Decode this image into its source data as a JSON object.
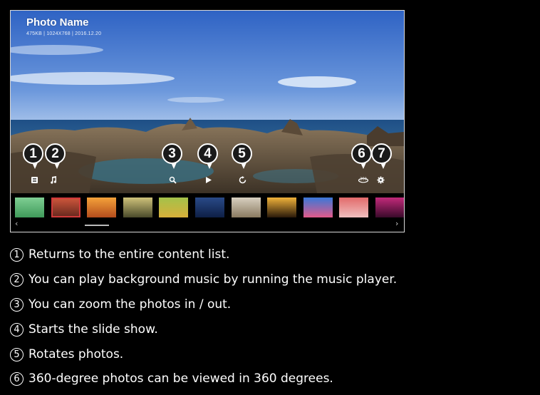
{
  "photo": {
    "title": "Photo Name",
    "meta": "475KB  |  1024X768  |  2016.12.20"
  },
  "controls": [
    {
      "icon": "content-list-icon"
    },
    {
      "icon": "music-note-icon"
    },
    {
      "icon": "zoom-icon"
    },
    {
      "icon": "play-icon"
    },
    {
      "icon": "rotate-icon"
    },
    {
      "icon": "360-view-icon"
    },
    {
      "icon": "settings-gear-icon"
    }
  ],
  "callouts": [
    "1",
    "2",
    "3",
    "4",
    "5",
    "6",
    "7"
  ],
  "thumbnails": {
    "count": 12,
    "selected_index": 1,
    "scroll_left_icon": "‹",
    "scroll_right_icon": "›"
  },
  "descriptions": [
    {
      "num": "1",
      "text": "Returns to the entire content list."
    },
    {
      "num": "2",
      "text": "You can play background music by running the music player."
    },
    {
      "num": "3",
      "text": "You can zoom the photos in / out."
    },
    {
      "num": "4",
      "text": "Starts the slide show."
    },
    {
      "num": "5",
      "text": "Rotates photos."
    },
    {
      "num": "6",
      "text": "360-degree photos can be viewed in 360 degrees."
    }
  ],
  "colors": {
    "sky_top": "#2f63c4",
    "sky_bottom": "#8fb4e6",
    "sea": "#2e5f8f",
    "rock": "#6b5a45",
    "selected_border": "#d23a3a"
  }
}
